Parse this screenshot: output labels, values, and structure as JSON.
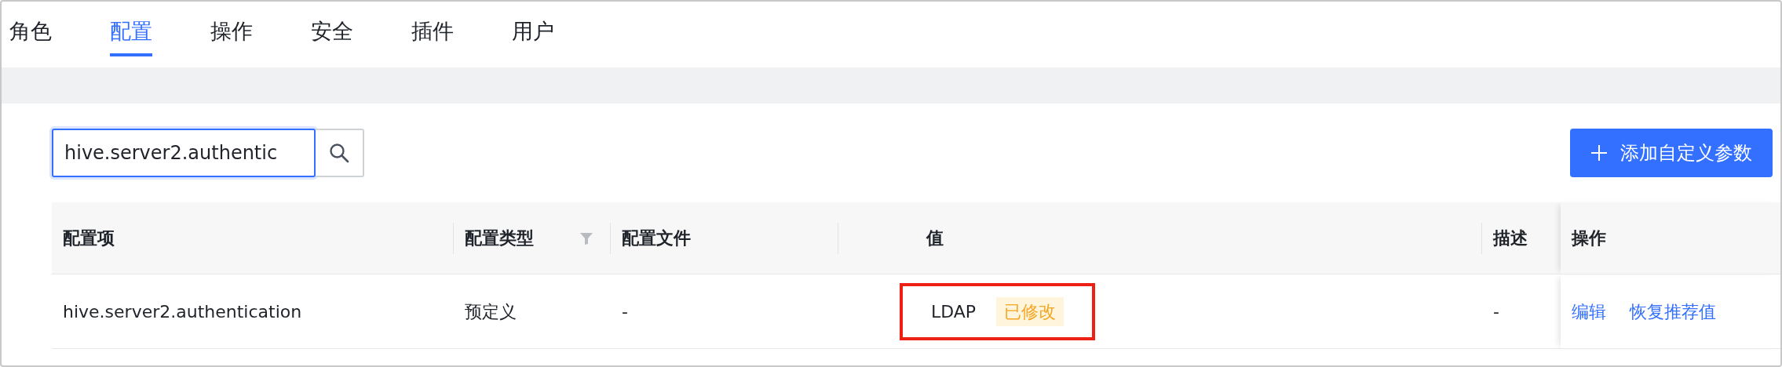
{
  "tabs": [
    {
      "label": "角色",
      "selected": false
    },
    {
      "label": "配置",
      "selected": true
    },
    {
      "label": "操作",
      "selected": false
    },
    {
      "label": "安全",
      "selected": false
    },
    {
      "label": "插件",
      "selected": false
    },
    {
      "label": "用户",
      "selected": false
    }
  ],
  "search": {
    "value": "hive.server2.authentic"
  },
  "add_button": {
    "label": "添加自定义参数"
  },
  "table": {
    "columns": [
      {
        "label": "配置项",
        "filter": false
      },
      {
        "label": "配置类型",
        "filter": true
      },
      {
        "label": "配置文件",
        "filter": false
      },
      {
        "label": "值",
        "filter": false
      },
      {
        "label": "描述",
        "filter": false
      },
      {
        "label": "操作",
        "filter": false
      }
    ],
    "rows": [
      {
        "name": "hive.server2.authentication",
        "type": "预定义",
        "file": "-",
        "value": "LDAP",
        "tag": "已修改",
        "highlighted": true,
        "description": "-",
        "actions": [
          "编辑",
          "恢复推荐值"
        ]
      }
    ]
  }
}
